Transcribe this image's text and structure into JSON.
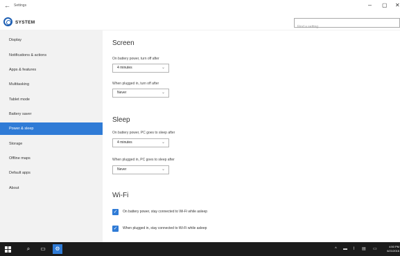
{
  "window": {
    "back_glyph": "←",
    "title": "Settings",
    "minimize_glyph": "–",
    "maximize_glyph": "▢",
    "close_glyph": "✕"
  },
  "header": {
    "icon": "gear-icon",
    "section_title": "SYSTEM",
    "search_placeholder": "Find a setting"
  },
  "sidebar": {
    "selected_index": 6,
    "items": [
      {
        "label": "Display"
      },
      {
        "label": "Notifications & actions"
      },
      {
        "label": "Apps & features"
      },
      {
        "label": "Multitasking"
      },
      {
        "label": "Tablet mode"
      },
      {
        "label": "Battery saver"
      },
      {
        "label": "Power & sleep"
      },
      {
        "label": "Storage"
      },
      {
        "label": "Offline maps"
      },
      {
        "label": "Default apps"
      },
      {
        "label": "About"
      }
    ]
  },
  "main": {
    "screen": {
      "heading": "Screen",
      "battery_label": "On battery power, turn off after",
      "battery_value": "4 minutes",
      "plugged_label": "When plugged in, turn off after",
      "plugged_value": "Never"
    },
    "sleep": {
      "heading": "Sleep",
      "battery_label": "On battery power, PC goes to sleep after",
      "battery_value": "4 minutes",
      "plugged_label": "When plugged in, PC goes to sleep after",
      "plugged_value": "Never"
    },
    "wifi": {
      "heading": "Wi-Fi",
      "battery_checkbox": {
        "label": "On battery power, stay connected to Wi-Fi while asleep",
        "checked": true
      },
      "plugged_checkbox": {
        "label": "When plugged in, stay connected to Wi-Fi while asleep",
        "checked": true
      }
    },
    "chevron_glyph": "⌄",
    "check_glyph": "✓"
  },
  "taskbar": {
    "search_glyph": "⌕",
    "task_view_glyph": "▭",
    "settings_glyph": "⚙",
    "tray_up_glyph": "^",
    "tray_battery_glyph": "▬",
    "tray_wifi_glyph": "⌇",
    "tray_keyboard_glyph": "▤",
    "tray_message_glyph": "▭",
    "clock_time": "4:50 PM",
    "clock_date": "6/21/2016"
  },
  "colors": {
    "accent": "#2f7bd6",
    "gear": "#1e5fb3",
    "sidebar_bg": "#f2f2f2",
    "taskbar_bg": "#1b1b1b"
  }
}
